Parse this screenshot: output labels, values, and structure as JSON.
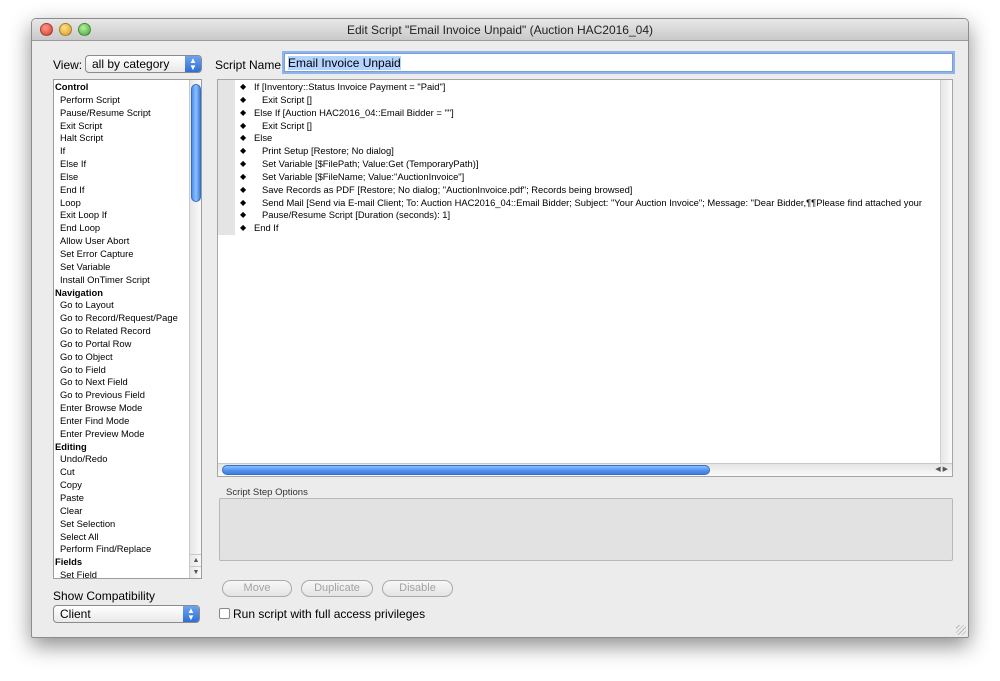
{
  "window": {
    "title": "Edit Script \"Email Invoice Unpaid\" (Auction HAC2016_04)"
  },
  "view": {
    "label": "View:",
    "selected": "all by category"
  },
  "script_name": {
    "label": "Script Name:",
    "value": "Email Invoice Unpaid"
  },
  "steps": [
    {
      "label": "Control",
      "category": true
    },
    {
      "label": "Perform Script"
    },
    {
      "label": "Pause/Resume Script"
    },
    {
      "label": "Exit Script"
    },
    {
      "label": "Halt Script"
    },
    {
      "label": "If"
    },
    {
      "label": "Else If"
    },
    {
      "label": "Else"
    },
    {
      "label": "End If"
    },
    {
      "label": "Loop"
    },
    {
      "label": "Exit Loop If"
    },
    {
      "label": "End Loop"
    },
    {
      "label": "Allow User Abort"
    },
    {
      "label": "Set Error Capture"
    },
    {
      "label": "Set Variable"
    },
    {
      "label": "Install OnTimer Script"
    },
    {
      "label": "Navigation",
      "category": true
    },
    {
      "label": "Go to Layout"
    },
    {
      "label": "Go to Record/Request/Page"
    },
    {
      "label": "Go to Related Record"
    },
    {
      "label": "Go to Portal Row"
    },
    {
      "label": "Go to Object"
    },
    {
      "label": "Go to Field"
    },
    {
      "label": "Go to Next Field"
    },
    {
      "label": "Go to Previous Field"
    },
    {
      "label": "Enter Browse Mode"
    },
    {
      "label": "Enter Find Mode"
    },
    {
      "label": "Enter Preview Mode"
    },
    {
      "label": "Editing",
      "category": true
    },
    {
      "label": "Undo/Redo"
    },
    {
      "label": "Cut"
    },
    {
      "label": "Copy"
    },
    {
      "label": "Paste"
    },
    {
      "label": "Clear"
    },
    {
      "label": "Set Selection"
    },
    {
      "label": "Select All"
    },
    {
      "label": "Perform Find/Replace"
    },
    {
      "label": "Fields",
      "category": true
    },
    {
      "label": "Set Field"
    }
  ],
  "script_lines": [
    {
      "indent": 0,
      "text": "If [Inventory::Status Invoice Payment = \"Paid\"]"
    },
    {
      "indent": 1,
      "text": "Exit Script []"
    },
    {
      "indent": 0,
      "text": "Else If [Auction HAC2016_04::Email Bidder = \"\"]"
    },
    {
      "indent": 1,
      "text": "Exit Script []"
    },
    {
      "indent": 0,
      "text": "Else"
    },
    {
      "indent": 1,
      "text": "Print Setup [Restore; No dialog]"
    },
    {
      "indent": 1,
      "text": "Set Variable [$FilePath; Value:Get (TemporaryPath)]"
    },
    {
      "indent": 1,
      "text": "Set Variable [$FileName; Value:\"AuctionInvoice\"]"
    },
    {
      "indent": 1,
      "text": "Save Records as PDF [Restore; No dialog; \"AuctionInvoice.pdf\"; Records being browsed]"
    },
    {
      "indent": 1,
      "text": "Send Mail [Send via E-mail Client; To: Auction HAC2016_04::Email Bidder; Subject: \"Your Auction Invoice\"; Message: \"Dear Bidder,¶¶Please find attached your"
    },
    {
      "indent": 1,
      "text": "Pause/Resume Script [Duration (seconds): 1]"
    },
    {
      "indent": 0,
      "text": "End If"
    }
  ],
  "options": {
    "label": "Script Step Options"
  },
  "buttons": {
    "move": "Move",
    "duplicate": "Duplicate",
    "disable": "Disable"
  },
  "full_access": {
    "label": "Run script with full access privileges",
    "checked": false
  },
  "compat": {
    "label": "Show Compatibility",
    "selected": "Client"
  }
}
